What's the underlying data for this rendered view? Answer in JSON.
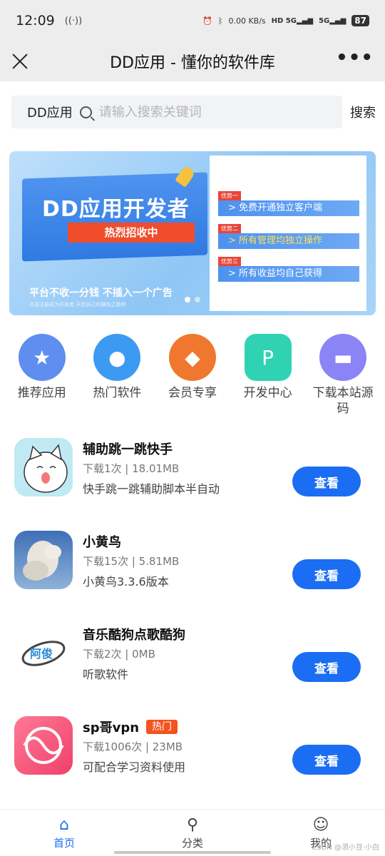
{
  "status": {
    "time": "12:09",
    "speed": "0.00 KB/s",
    "battery": "87"
  },
  "nav": {
    "title": "DD应用 - 懂你的软件库",
    "more": "•••"
  },
  "search": {
    "prefix": "DD应用",
    "placeholder": "请输入搜索关键词",
    "button": "搜索"
  },
  "banner": {
    "title": "DD应用开发者",
    "ribbon": "热烈招收中",
    "slogan": "平台不收一分钱 不插入一个广告",
    "sub": "点击注册成为开发者 开启自己的赚钱之路吧",
    "advantages": [
      {
        "tag": "优势一",
        "text": "> 免费开通独立客户端"
      },
      {
        "tag": "优势二",
        "text": "> 所有管理均独立操作"
      },
      {
        "tag": "优势三",
        "text": "> 所有收益均自己获得"
      }
    ]
  },
  "quick": [
    {
      "label": "推荐应用",
      "color": "#5f8ef0"
    },
    {
      "label": "热门软件",
      "color": "#3d9af2"
    },
    {
      "label": "会员专享",
      "color": "#f0782e"
    },
    {
      "label": "开发中心",
      "color": "#2fd3b4"
    },
    {
      "label": "下载本站源码",
      "color": "#8b84f6"
    }
  ],
  "apps": [
    {
      "name": "辅助跳一跳快手",
      "meta": "下载1次 | 18.01MB",
      "desc": "快手跳一跳辅助脚本半自动",
      "badge": "",
      "button": "查看"
    },
    {
      "name": "小黄鸟",
      "meta": "下载15次 | 5.81MB",
      "desc": "小黄鸟3.3.6版本",
      "badge": "",
      "button": "查看"
    },
    {
      "name": "音乐酷狗点歌酷狗",
      "meta": "下载2次 | 0MB",
      "desc": "听歌软件",
      "badge": "",
      "button": "查看"
    },
    {
      "name": "sp哥vpn",
      "meta": "下载1006次 | 23MB",
      "desc": "可配合学习资料使用",
      "badge": "热门",
      "button": "查看"
    }
  ],
  "icon4_text": "阿俊",
  "tabs": [
    {
      "label": "首页"
    },
    {
      "label": "分类"
    },
    {
      "label": "我的"
    }
  ],
  "watermark": "CSDN @须小豆·小白",
  "colors": {
    "primary": "#1b6ef3",
    "hot": "#f2531f"
  }
}
